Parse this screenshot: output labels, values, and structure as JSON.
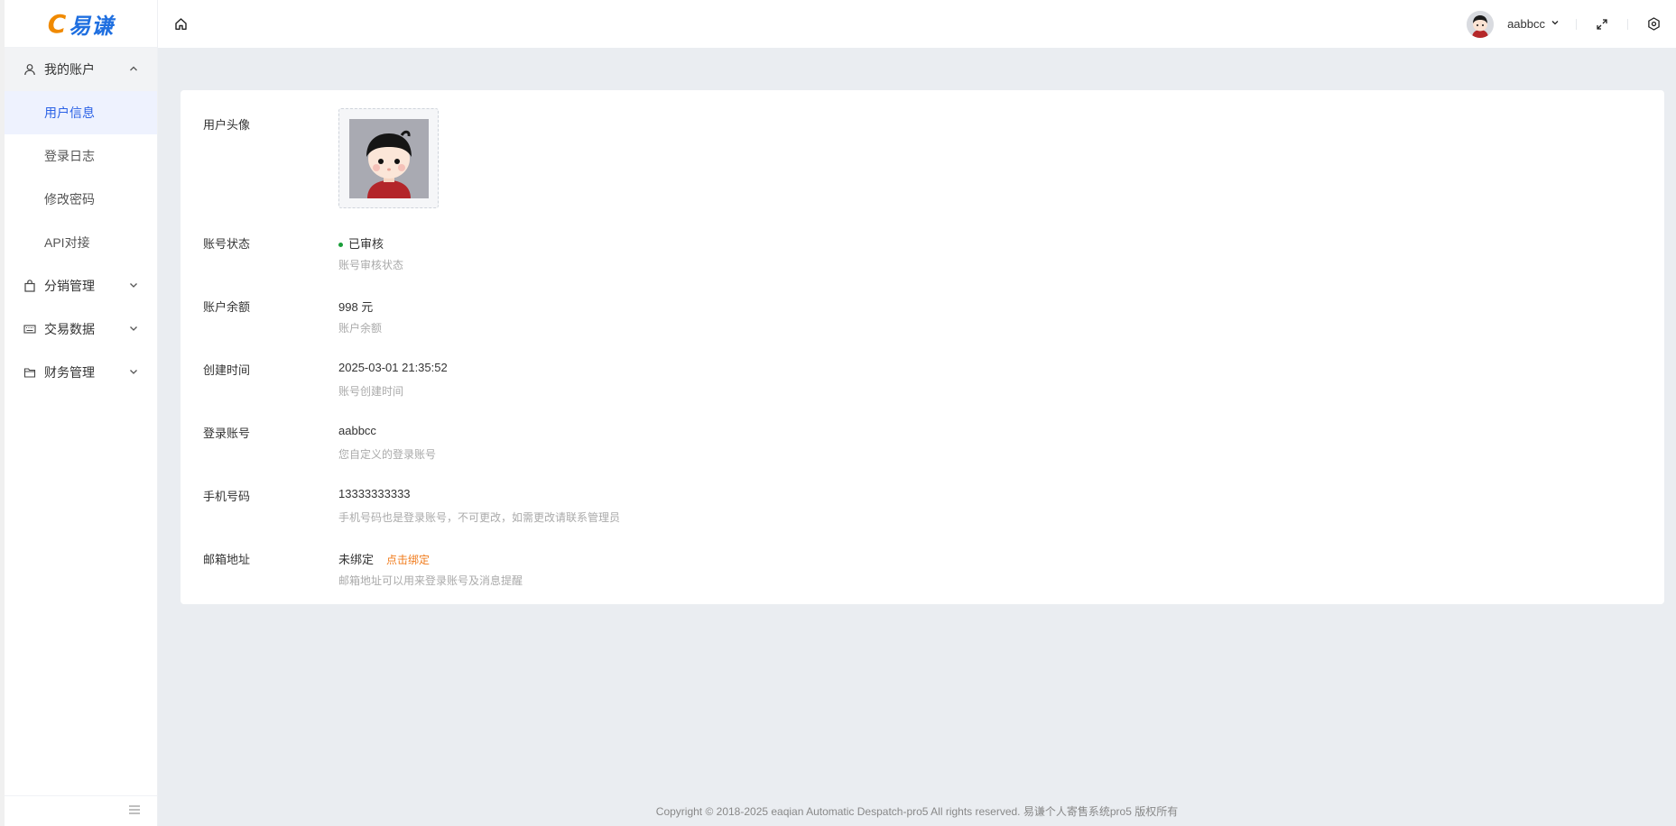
{
  "brand": {
    "logo_text": "易谦",
    "logo_mark": "C"
  },
  "sidebar": {
    "group": {
      "label": "我的账户",
      "icon": "user-icon"
    },
    "sub_items": [
      {
        "label": "用户信息"
      },
      {
        "label": "登录日志"
      },
      {
        "label": "修改密码"
      },
      {
        "label": "API对接"
      }
    ],
    "items": [
      {
        "label": "分销管理",
        "icon": "bag-icon"
      },
      {
        "label": "交易数据",
        "icon": "keyboard-icon"
      },
      {
        "label": "财务管理",
        "icon": "folder-icon"
      }
    ]
  },
  "header": {
    "username": "aabbcc"
  },
  "profile": {
    "avatar_label": "用户头像",
    "status_label": "账号状态",
    "status_value": "已审核",
    "status_hint": "账号审核状态",
    "balance_label": "账户余额",
    "balance_value": "998 元",
    "balance_hint": "账户余额",
    "created_label": "创建时间",
    "created_value": "2025-03-01 21:35:52",
    "created_hint": "账号创建时间",
    "login_label": "登录账号",
    "login_value": "aabbcc",
    "login_hint": "您自定义的登录账号",
    "phone_label": "手机号码",
    "phone_value": "13333333333",
    "phone_hint": "手机号码也是登录账号，不可更改，如需更改请联系管理员",
    "email_label": "邮箱地址",
    "email_value": "未绑定",
    "email_link": "点击绑定",
    "email_hint": "邮箱地址可以用来登录账号及消息提醒"
  },
  "colors": {
    "accent": "#2b62e6",
    "link_orange": "#f07a1a",
    "status_green": "#1a9e3a"
  },
  "footer": {
    "text": "Copyright © 2018-2025 eaqian Automatic Despatch-pro5 All rights reserved. 易谦个人寄售系统pro5 版权所有"
  }
}
